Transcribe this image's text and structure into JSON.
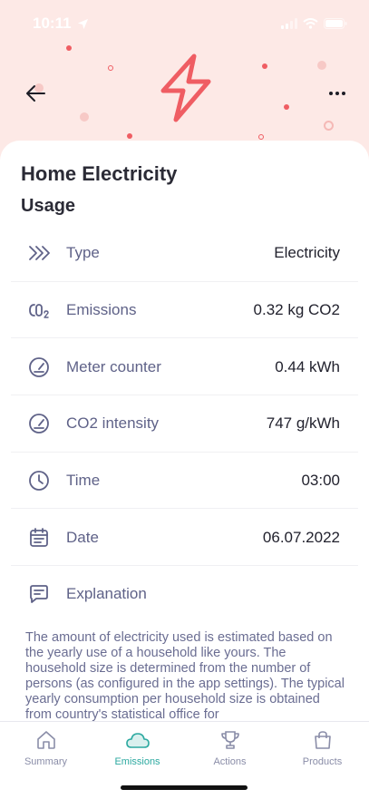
{
  "status_bar": {
    "time": "10:11"
  },
  "header": {
    "back_icon": "arrow-left-icon",
    "more_icon": "more-horizontal-icon",
    "hero_icon": "lightning-bolt-icon"
  },
  "page": {
    "title": "Home Electricity",
    "section_title": "Usage"
  },
  "details": [
    {
      "icon": "chevrons-right-icon",
      "label": "Type",
      "value": "Electricity"
    },
    {
      "icon": "co2-icon",
      "label": "Emissions",
      "value": "0.32 kg CO2"
    },
    {
      "icon": "gauge-icon",
      "label": "Meter counter",
      "value": "0.44 kWh"
    },
    {
      "icon": "gauge-icon",
      "label": "CO2 intensity",
      "value": "747 g/kWh"
    },
    {
      "icon": "clock-icon",
      "label": "Time",
      "value": "03:00"
    },
    {
      "icon": "calendar-icon",
      "label": "Date",
      "value": "06.07.2022"
    },
    {
      "icon": "chat-icon",
      "label": "Explanation",
      "value": ""
    }
  ],
  "explanation_text": "The amount of electricity used is estimated based on the yearly use of a household like yours. The household size is determined from the number of persons (as configured  in the app settings). The typical yearly consumption per household size is obtained from country's statistical office for",
  "tabs": [
    {
      "label": "Summary",
      "icon": "home-icon",
      "active": false
    },
    {
      "label": "Emissions",
      "icon": "cloud-icon",
      "active": true
    },
    {
      "label": "Actions",
      "icon": "trophy-icon",
      "active": false
    },
    {
      "label": "Products",
      "icon": "shopping-bag-icon",
      "active": false
    }
  ],
  "colors": {
    "hero_bg": "#fde9e6",
    "accent_red": "#ef5d63",
    "active_tab": "#2ca9a0",
    "label_text": "#5f6288"
  }
}
